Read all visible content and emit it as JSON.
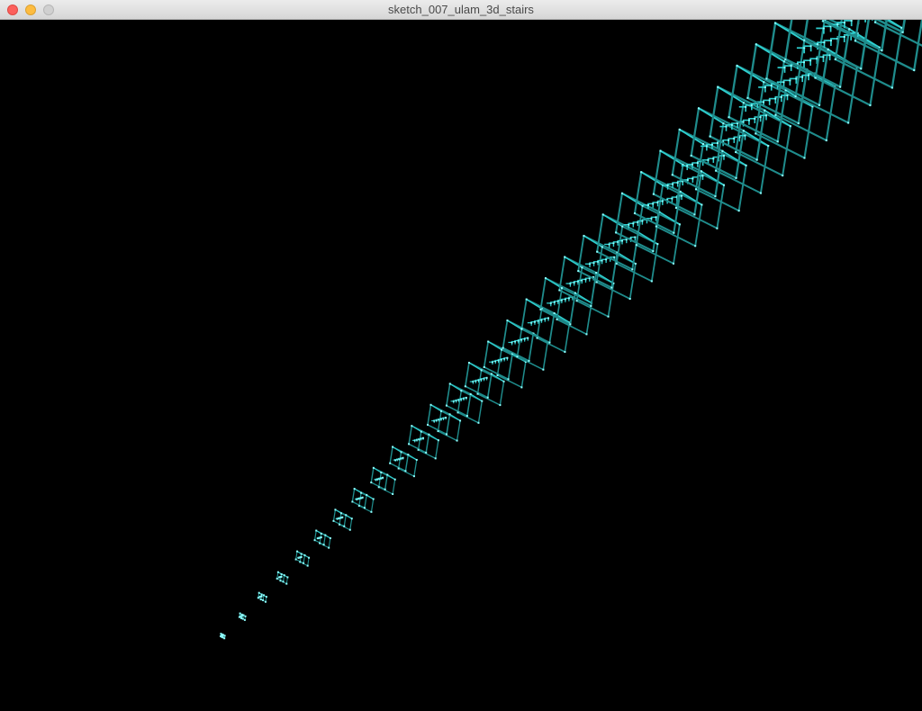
{
  "window": {
    "title": "sketch_007_ulam_3d_stairs",
    "controls": [
      "close",
      "minimize",
      "zoom"
    ]
  },
  "canvas": {
    "background": "#000000",
    "stroke_color": "#1f8c8c",
    "highlight_color": "#2fd0d0",
    "point_color": "#8fffff",
    "content": "3d-ulam-spiral-stairs"
  }
}
